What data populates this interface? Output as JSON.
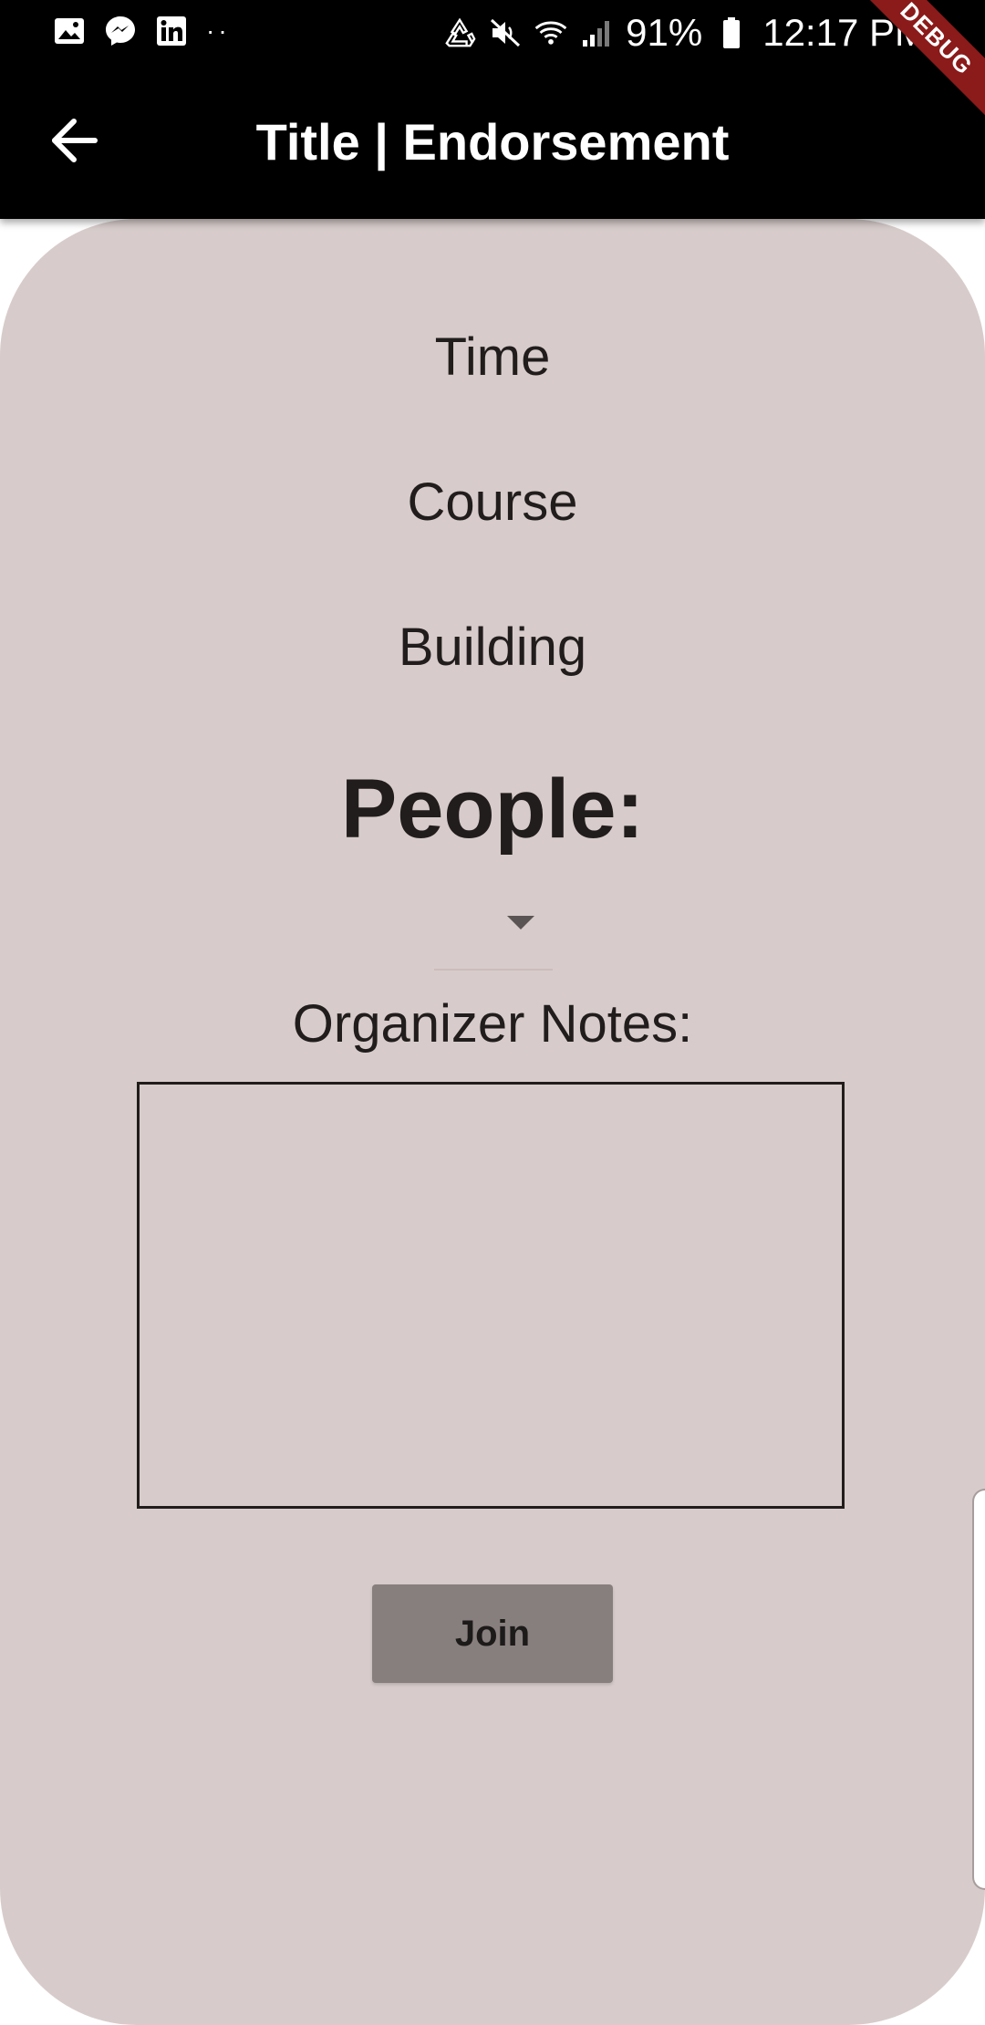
{
  "status_bar": {
    "notification_icons": [
      "gallery-icon",
      "messenger-icon",
      "linkedin-icon"
    ],
    "more_dots": "··",
    "battery_percent": "91%",
    "time": "12:17 PM"
  },
  "app_bar": {
    "title": "Title | Endorsement",
    "back_icon": "arrow-left-icon"
  },
  "debug_banner": "DEBUG",
  "content": {
    "time_label": "Time",
    "course_label": "Course",
    "building_label": "Building",
    "people_heading": "People:",
    "people_dropdown_value": "",
    "organizer_notes_label": "Organizer Notes:",
    "organizer_notes_value": "",
    "join_button_label": "Join"
  },
  "colors": {
    "status_bar": "#000000",
    "app_bar": "#000000",
    "card_background": "#d7cccb",
    "join_button": "#877f7e",
    "debug_banner": "#8b1a1a",
    "text": "#211d1d"
  }
}
